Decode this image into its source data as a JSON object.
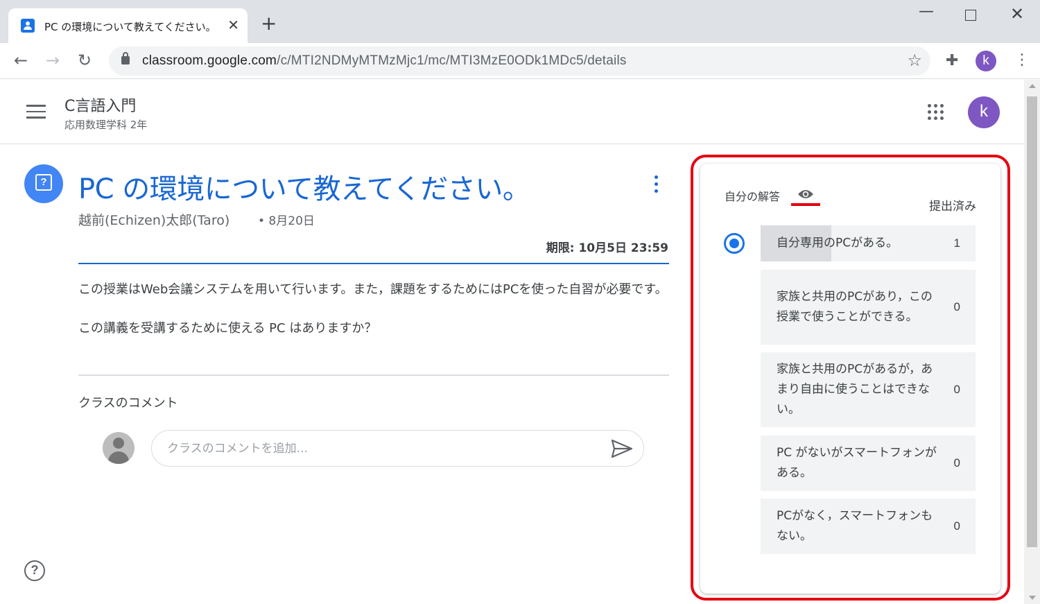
{
  "browser": {
    "tab_title": "PC の環境について教えてください。",
    "url_host": "classroom.google.com",
    "url_path": "/c/MTI2NDMyMTMzMjc1/mc/MTI3MzE0ODk1MDc5/details",
    "profile_initial": "k"
  },
  "header": {
    "class_name": "C言語入門",
    "class_section": "応用数理学科 2年",
    "avatar_initial": "k"
  },
  "question": {
    "title": "PC の環境について教えてください。",
    "author": "越前(Echizen)太郎(Taro)",
    "date": "• 8月20日",
    "due": "期限: 10月5日 23:59",
    "description": [
      "この授業はWeb会議システムを用いて行います。また，課題をするためにはPCを使った自習が必要です。",
      "この講義を受講するために使える PC はありますか？"
    ]
  },
  "comments": {
    "label": "クラスのコメント",
    "placeholder": "クラスのコメントを追加..."
  },
  "answer_panel": {
    "your_answer_label": "自分の解答",
    "status": "提出済み",
    "options": [
      {
        "text": "自分専用のPCがある。",
        "count": "1",
        "share": 0.33,
        "selected": true
      },
      {
        "text": "家族と共用のPCがあり，この授業で使うことができる。",
        "count": "0",
        "share": 0,
        "selected": false
      },
      {
        "text": "家族と共用のPCがあるが，あまり自由に使うことはできない。",
        "count": "0",
        "share": 0,
        "selected": false
      },
      {
        "text": "PC がないがスマートフォンがある。",
        "count": "0",
        "share": 0,
        "selected": false
      },
      {
        "text": "PCがなく，スマートフォンもない。",
        "count": "0",
        "share": 0,
        "selected": false
      }
    ]
  },
  "colors": {
    "accent_blue": "#1967d2",
    "highlight_red": "#e60012",
    "avatar_purple": "#7e57c2"
  }
}
